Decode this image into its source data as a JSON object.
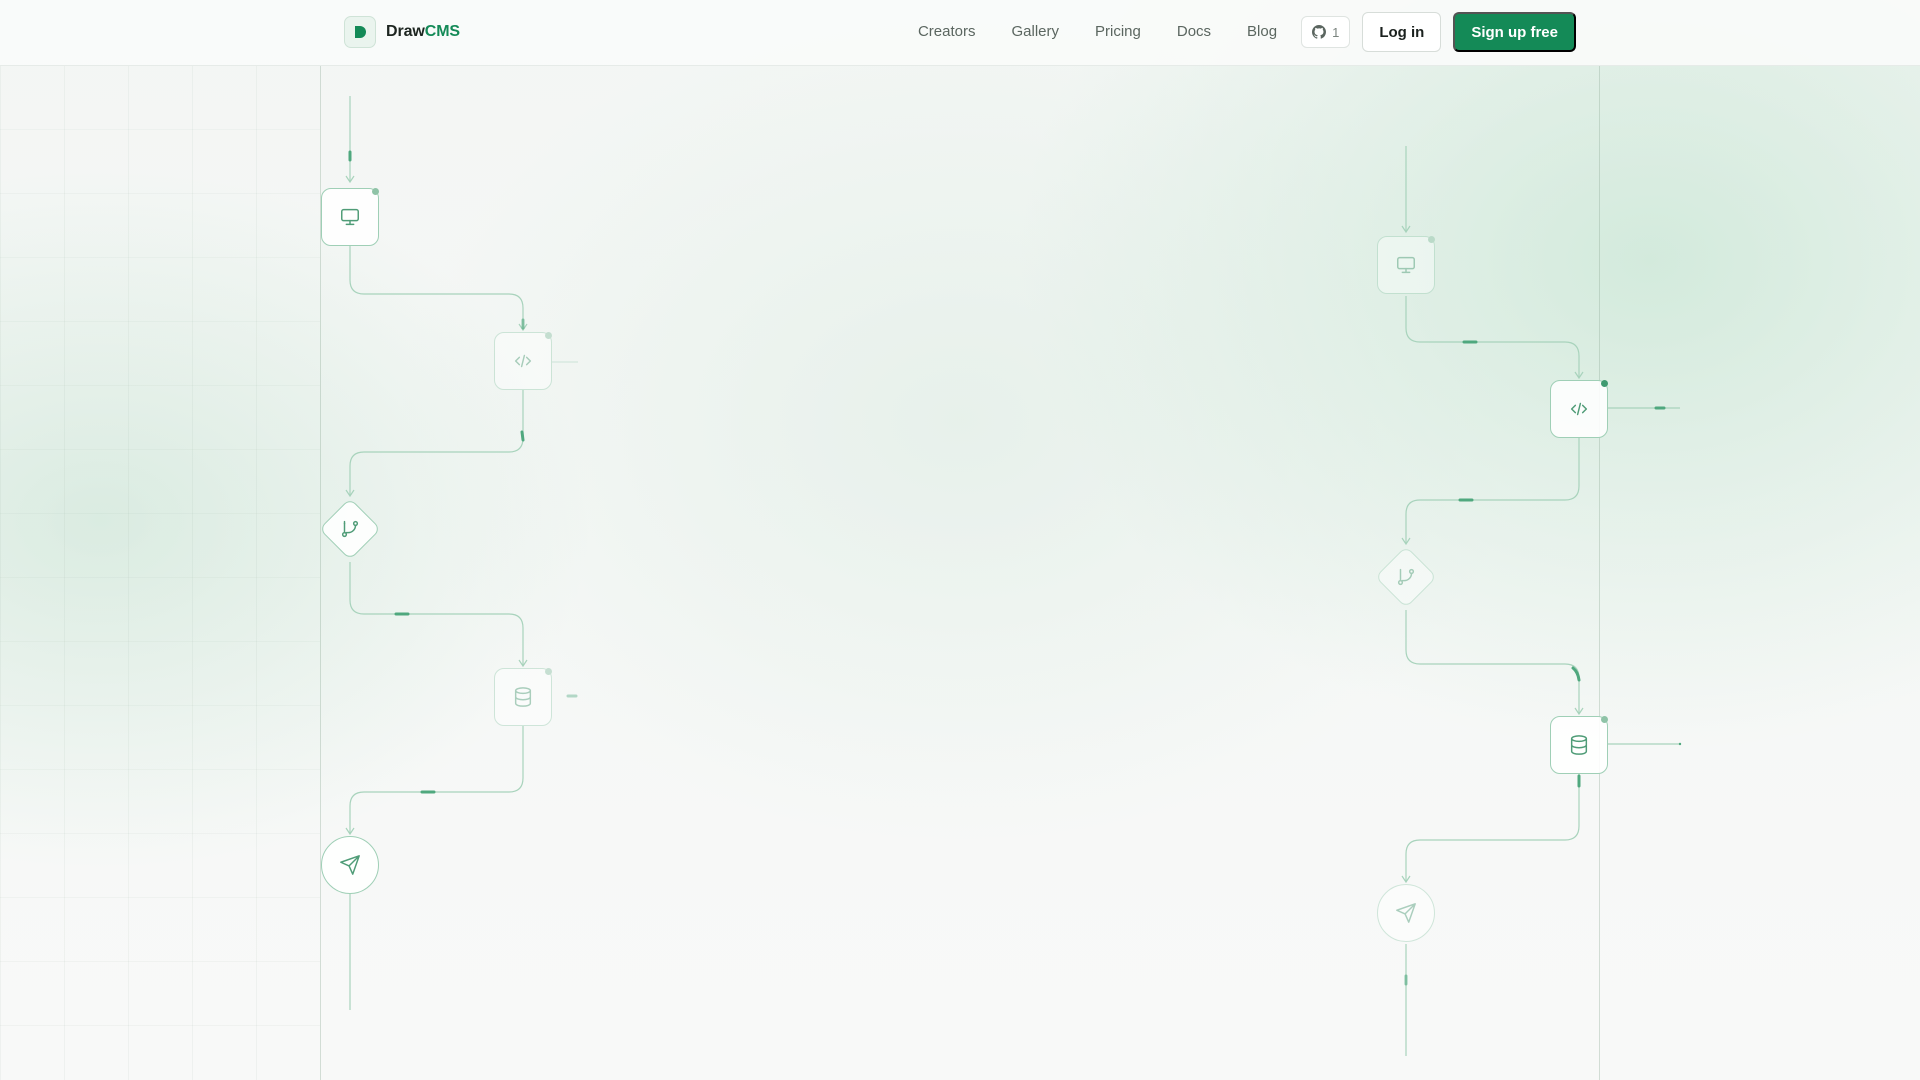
{
  "brand": {
    "name_part1": "Draw",
    "name_part2": "CMS",
    "accent_color": "#148a57"
  },
  "nav": {
    "links": [
      "Creators",
      "Gallery",
      "Pricing",
      "Docs",
      "Blog"
    ],
    "github_stars": "1",
    "login_label": "Log in",
    "signup_label": "Sign up free"
  },
  "flow_icons": {
    "left": [
      "monitor-icon",
      "code-icon",
      "git-branch-icon",
      "database-icon",
      "send-icon"
    ],
    "right": [
      "monitor-icon",
      "code-icon",
      "git-branch-icon",
      "database-icon",
      "send-icon"
    ]
  },
  "colors": {
    "line": "#a8d3bc",
    "pulse": "#4fa87e",
    "button_primary": "#148a57"
  }
}
